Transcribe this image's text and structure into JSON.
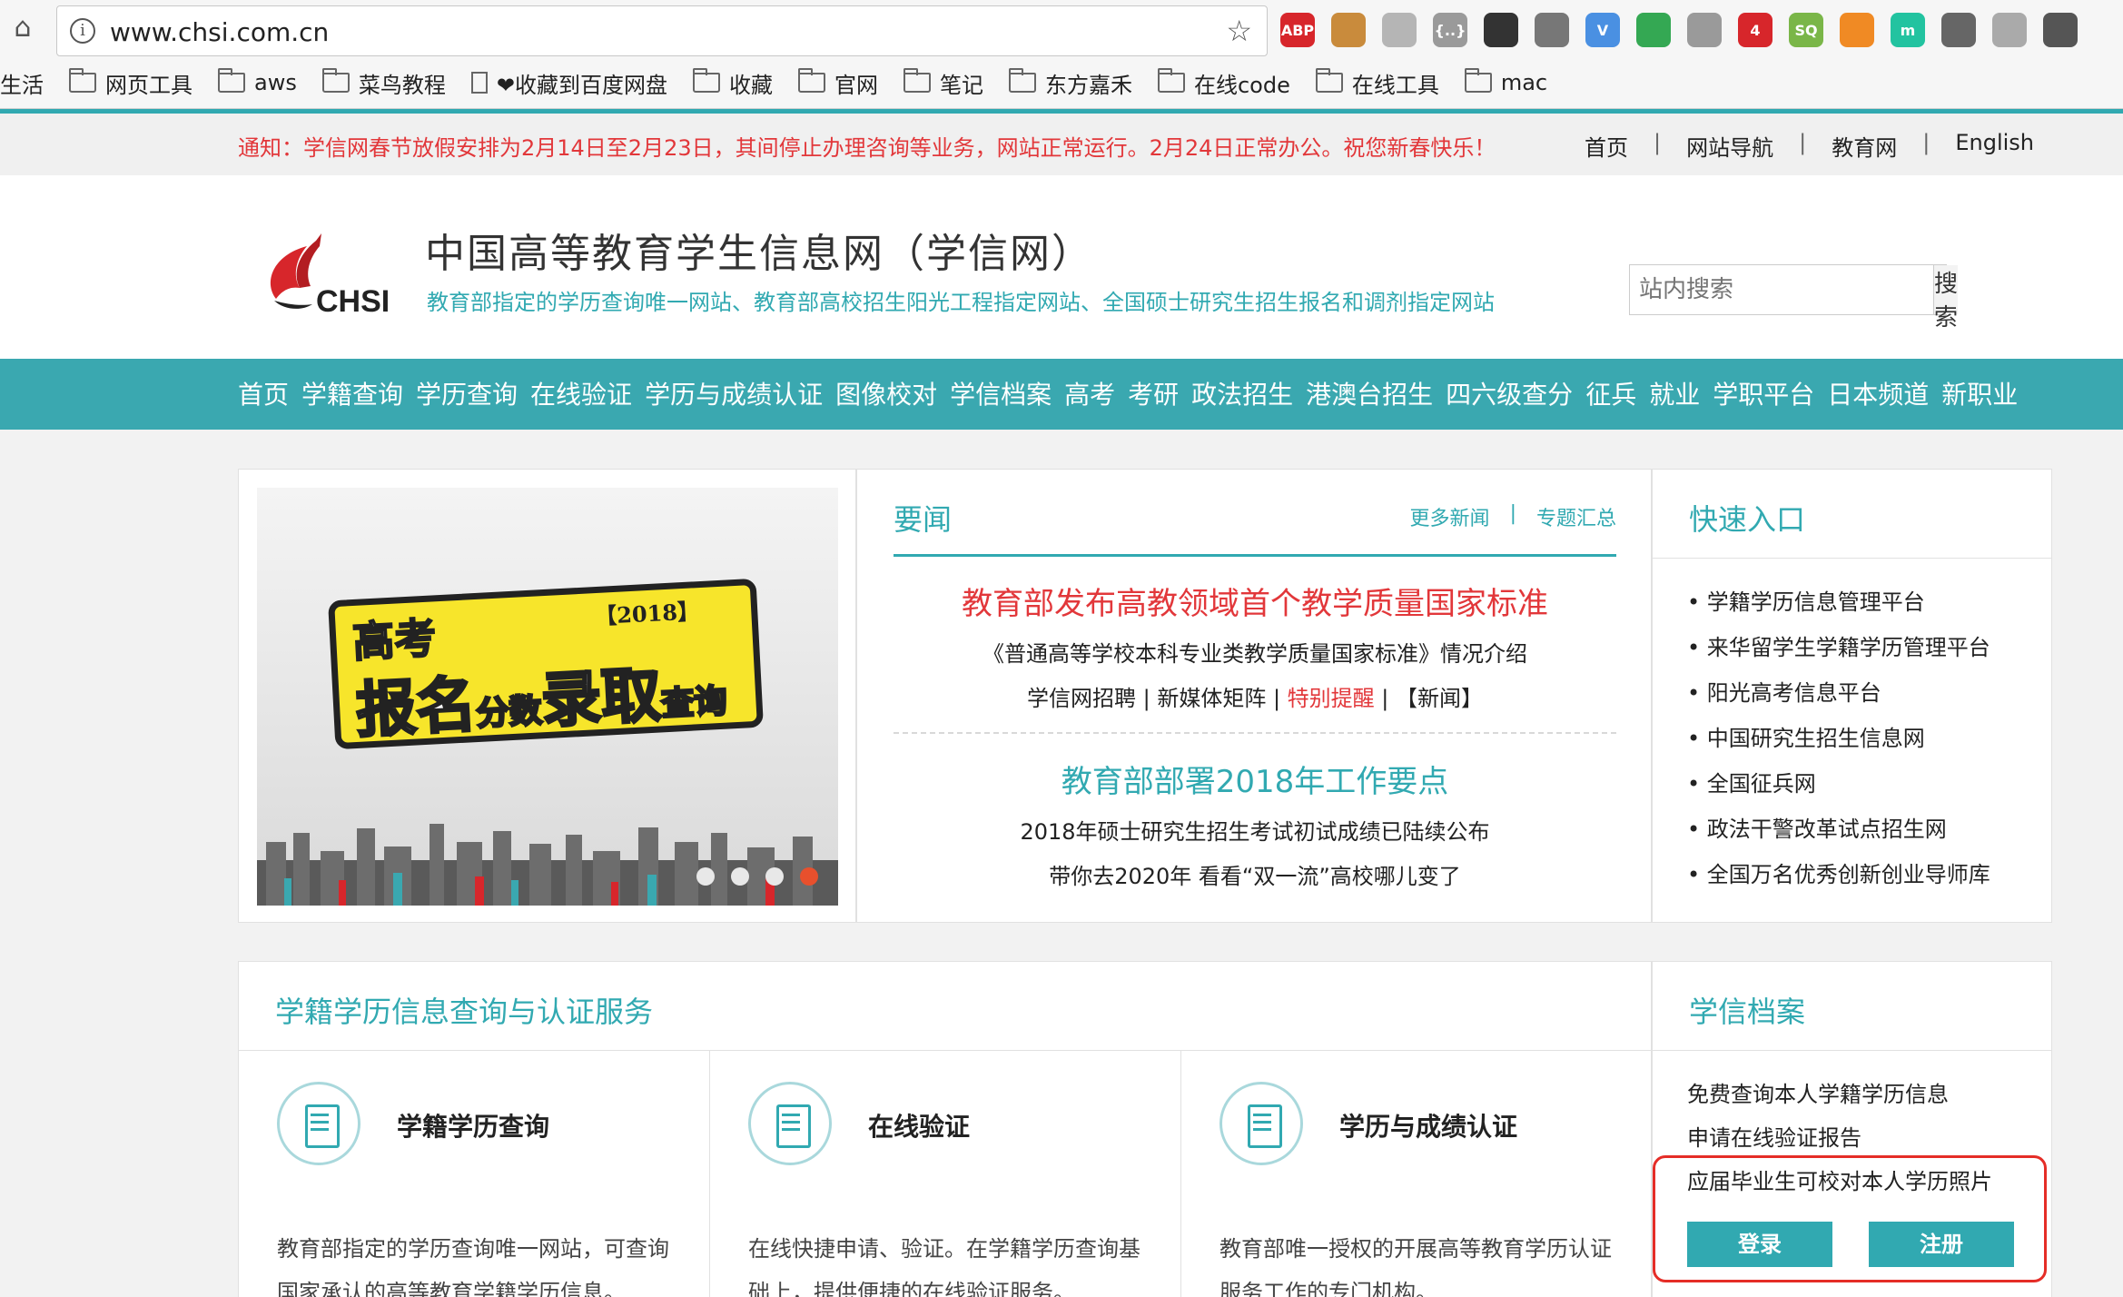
{
  "browser": {
    "url": "www.chsi.com.cn",
    "bookmarks": [
      {
        "label": "生活",
        "kind": "none"
      },
      {
        "label": "网页工具",
        "kind": "folder"
      },
      {
        "label": "aws",
        "kind": "folder"
      },
      {
        "label": "菜鸟教程",
        "kind": "folder"
      },
      {
        "label": "❤收藏到百度网盘",
        "kind": "page"
      },
      {
        "label": "收藏",
        "kind": "folder"
      },
      {
        "label": "官网",
        "kind": "folder"
      },
      {
        "label": "笔记",
        "kind": "folder"
      },
      {
        "label": "东方嘉禾",
        "kind": "folder"
      },
      {
        "label": "在线code",
        "kind": "folder"
      },
      {
        "label": "在线工具",
        "kind": "folder"
      },
      {
        "label": "mac",
        "kind": "folder"
      }
    ],
    "extensions": [
      {
        "icon": "adblock-icon",
        "text": "ABP",
        "color": "#d7262b"
      },
      {
        "icon": "cookie-icon",
        "text": "",
        "color": "#c98b3c"
      },
      {
        "icon": "photo-icon",
        "text": "",
        "color": "#b5b5b5"
      },
      {
        "icon": "json-icon",
        "text": "{..}",
        "color": "#9a9a9a"
      },
      {
        "icon": "qrcode-icon",
        "text": "",
        "color": "#333333"
      },
      {
        "icon": "mail-checker-icon",
        "text": "",
        "color": "#777777"
      },
      {
        "icon": "vimium-icon",
        "text": "V",
        "color": "#4a90e2"
      },
      {
        "icon": "chrome-color-icon",
        "text": "",
        "color": "#34a853"
      },
      {
        "icon": "drive-icon",
        "text": "",
        "color": "#9a9a9a"
      },
      {
        "icon": "todo-icon",
        "text": "4",
        "color": "#d7262b"
      },
      {
        "icon": "seo-icon",
        "text": "SQ",
        "color": "#7ab648"
      },
      {
        "icon": "lifebuoy-icon",
        "text": "",
        "color": "#f08a24"
      },
      {
        "icon": "m-icon",
        "text": "m",
        "color": "#22c3a0"
      },
      {
        "icon": "cursor-icon",
        "text": "",
        "color": "#666666"
      },
      {
        "icon": "plane-icon",
        "text": "",
        "color": "#aaaaaa"
      },
      {
        "icon": "screenshot-icon",
        "text": "",
        "color": "#555555"
      }
    ]
  },
  "notice": "通知：学信网春节放假安排为2月14日至2月23日，其间停止办理咨询等业务，网站正常运行。2月24日正常办公。祝您新春快乐！",
  "toplinks": [
    "首页",
    "网站导航",
    "教育网",
    "English"
  ],
  "header": {
    "logo_text": "CHSI",
    "title": "中国高等教育学生信息网（学信网）",
    "subtitle": "教育部指定的学历查询唯一网站、教育部高校招生阳光工程指定网站、全国硕士研究生招生报名和调剂指定网站",
    "search_placeholder": "站内搜索",
    "search_button": "搜索"
  },
  "nav": [
    "首页",
    "学籍查询",
    "学历查询",
    "在线验证",
    "学历与成绩认证",
    "图像校对",
    "学信档案",
    "高考",
    "考研",
    "政法招生",
    "港澳台招生",
    "四六级查分",
    "征兵",
    "就业",
    "学职平台",
    "日本频道",
    "新职业"
  ],
  "banner": {
    "line1": "高考",
    "year": "【2018】",
    "w1": "报名",
    "w2": "分数",
    "w3": "录取",
    "w4": "查询",
    "active_slide": 3
  },
  "news": {
    "title": "要闻",
    "more_news": "更多新闻",
    "topics": "专题汇总",
    "block1": {
      "headline": "教育部发布高教领域首个教学质量国家标准",
      "line1": "《普通高等学校本科专业类教学质量国家标准》情况介绍",
      "line2_a": "学信网招聘 | 新媒体矩阵 | ",
      "line2_b": "特别提醒",
      "line2_c": " | 【新闻】"
    },
    "block2": {
      "headline": "教育部部署2018年工作要点",
      "line1": "2018年硕士研究生招生考试初试成绩已陆续公布",
      "line2": "带你去2020年 看看“双一流”高校哪儿变了"
    }
  },
  "quick": {
    "title": "快速入口",
    "items": [
      "学籍学历信息管理平台",
      "来华留学生学籍学历管理平台",
      "阳光高考信息平台",
      "中国研究生招生信息网",
      "全国征兵网",
      "政法干警改革试点招生网",
      "全国万名优秀创新创业导师库"
    ]
  },
  "service": {
    "title": "学籍学历信息查询与认证服务",
    "items": [
      {
        "name": "学籍学历查询",
        "desc": "教育部指定的学历查询唯一网站，可查询国家承认的高等教育学籍学历信息。"
      },
      {
        "name": "在线验证",
        "desc": "在线快捷申请、验证。在学籍学历查询基础上，提供便捷的在线验证服务。"
      },
      {
        "name": "学历与成绩认证",
        "desc": "教育部唯一授权的开展高等教育学历认证服务工作的专门机构。"
      }
    ]
  },
  "archive": {
    "title": "学信档案",
    "items": [
      "免费查询本人学籍学历信息",
      "申请在线验证报告",
      "应届毕业生可校对本人学历照片"
    ],
    "login": "登录",
    "register": "注册",
    "highlight_color": "#e52d27"
  }
}
